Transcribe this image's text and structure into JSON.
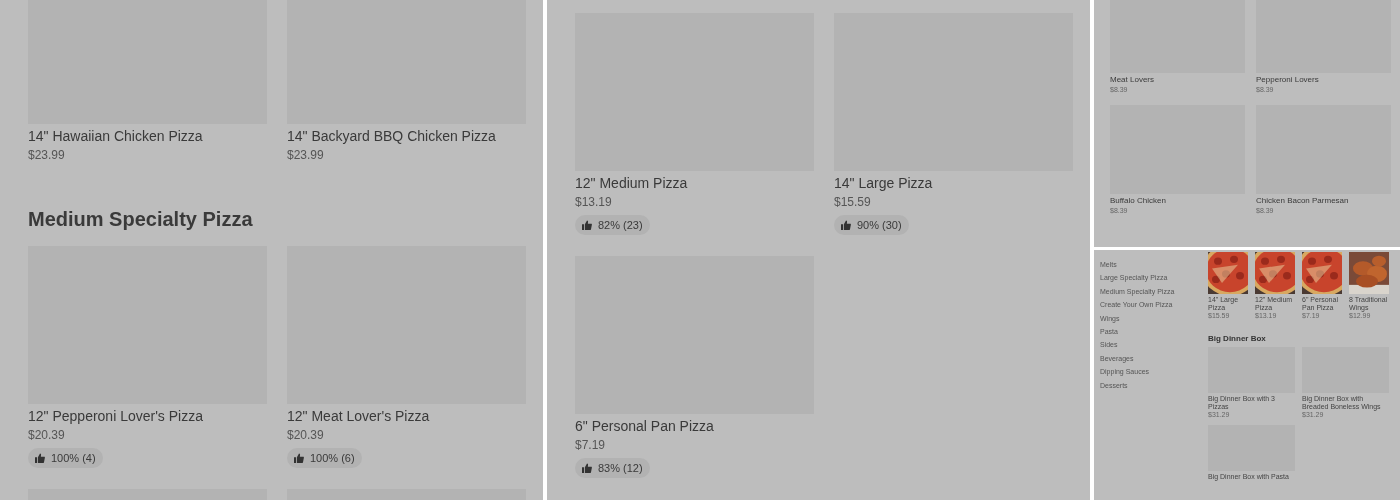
{
  "panels": [
    {
      "kind": "large",
      "sections": [
        {
          "items": [
            {
              "kind": "placeholder",
              "name": "14\" Hawaiian Chicken Pizza",
              "price": "$23.99"
            },
            {
              "kind": "placeholder",
              "name": "14\" Backyard BBQ Chicken Pizza",
              "price": "$23.99"
            }
          ]
        },
        {
          "heading": "Medium Specialty Pizza",
          "items": [
            {
              "kind": "placeholder",
              "name": "12\" Pepperoni Lover's Pizza",
              "price": "$20.39",
              "rating": "100% (4)"
            },
            {
              "kind": "placeholder",
              "name": "12\" Meat Lover's Pizza",
              "price": "$20.39",
              "rating": "100% (6)"
            },
            {
              "kind": "placeholder"
            },
            {
              "kind": "placeholder"
            }
          ]
        }
      ]
    },
    {
      "kind": "large",
      "sections": [
        {
          "items": [
            {
              "kind": "placeholder",
              "name": "12\" Medium Pizza",
              "price": "$13.19",
              "rating": "82% (23)"
            },
            {
              "kind": "placeholder",
              "name": "14\" Large Pizza",
              "price": "$15.59",
              "rating": "90% (30)"
            },
            {
              "kind": "placeholder",
              "name": "6\" Personal Pan Pizza",
              "price": "$7.19",
              "rating": "83% (12)"
            }
          ]
        }
      ]
    },
    {
      "kind": "compact",
      "sections": [
        {
          "items": [
            {
              "kind": "placeholder",
              "name": "Meat Lovers",
              "price": "$8.39"
            },
            {
              "kind": "placeholder",
              "name": "Pepperoni Lovers",
              "price": "$8.39"
            },
            {
              "kind": "placeholder",
              "name": "Buffalo Chicken",
              "price": "$8.39"
            },
            {
              "kind": "placeholder",
              "name": "Chicken Bacon Parmesan",
              "price": "$8.39"
            }
          ]
        }
      ]
    },
    {
      "kind": "thumb",
      "sidebar": [
        "Melts",
        "Large Specialty Pizza",
        "Medium Specialty Pizza",
        "Create Your Own Pizza",
        "Wings",
        "Pasta",
        "Sides",
        "Beverages",
        "Dipping Sauces",
        "Desserts"
      ],
      "sections": [
        {
          "items": [
            {
              "name": "14\" Large Pizza",
              "price": "$15.59"
            },
            {
              "name": "12\" Medium Pizza",
              "price": "$13.19"
            },
            {
              "name": "6\" Personal Pan Pizza",
              "price": "$7.19"
            },
            {
              "kind": "wings",
              "name": "8 Traditional Wings",
              "price": "$12.99"
            }
          ]
        },
        {
          "heading": "Big Dinner Box",
          "items": [
            {
              "kind": "placeholder",
              "name": "Big Dinner Box with 3 Pizzas",
              "price": "$31.29"
            },
            {
              "kind": "placeholder",
              "name": "Big Dinner Box with Breaded Boneless Wings",
              "price": "$31.29"
            },
            {
              "kind": "placeholder",
              "name": "Big Dinner Box with Pasta"
            }
          ]
        }
      ]
    }
  ]
}
